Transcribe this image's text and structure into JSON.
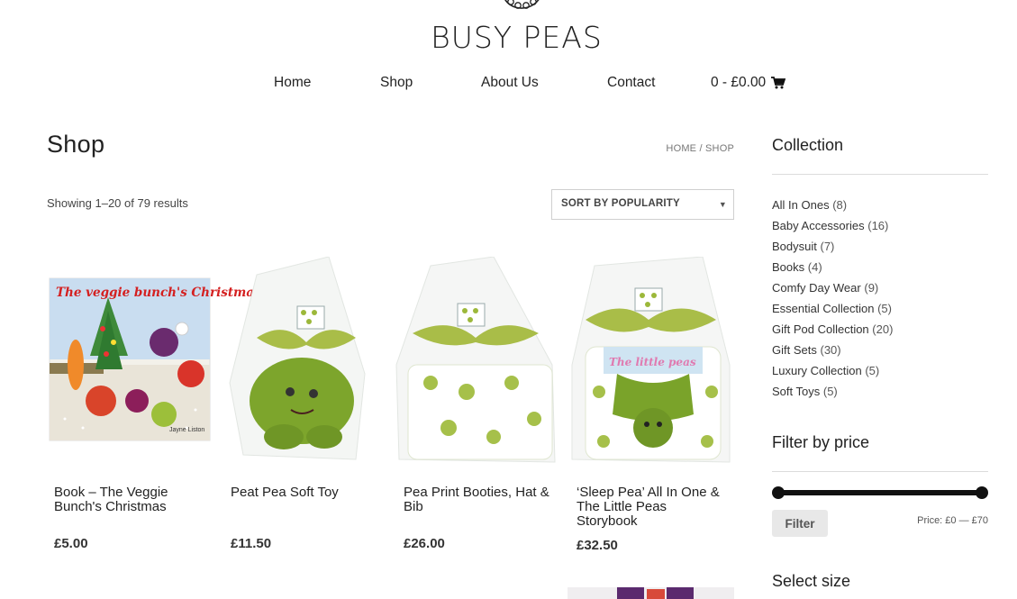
{
  "brand": {
    "name": "BUSY PEAS"
  },
  "nav": {
    "home": "Home",
    "shop": "Shop",
    "about": "About Us",
    "contact": "Contact",
    "cart": "0 - £0.00"
  },
  "page": {
    "title": "Shop",
    "breadcrumb_home": "HOME",
    "breadcrumb_sep": " / ",
    "breadcrumb_current": "SHOP",
    "result_count": "Showing 1–20 of 79 results",
    "sort": {
      "selected": "SORT BY POPULARITY"
    }
  },
  "products": [
    {
      "name": "Book – The Veggie Bunch's Christmas",
      "price": "£5.00",
      "image_title": "The veggie bunch's Christmas",
      "image_author": "Jayne Liston"
    },
    {
      "name": "Peat Pea Soft Toy",
      "price": "£11.50"
    },
    {
      "name": "Pea Print Booties, Hat & Bib",
      "price": "£26.00"
    },
    {
      "name": "‘Sleep Pea’ All In One & The Little Peas Storybook",
      "price": "£32.50",
      "image_label": "The little peas"
    }
  ],
  "sidebar": {
    "collection_title": "Collection",
    "categories": [
      {
        "label": "All In Ones",
        "count": "(8)"
      },
      {
        "label": "Baby Accessories",
        "count": "(16)"
      },
      {
        "label": "Bodysuit",
        "count": "(7)"
      },
      {
        "label": "Books",
        "count": "(4)"
      },
      {
        "label": "Comfy Day Wear",
        "count": "(9)"
      },
      {
        "label": "Essential Collection",
        "count": "(5)"
      },
      {
        "label": "Gift Pod Collection",
        "count": "(20)"
      },
      {
        "label": "Gift Sets",
        "count": "(30)"
      },
      {
        "label": "Luxury Collection",
        "count": "(5)"
      },
      {
        "label": "Soft Toys",
        "count": "(5)"
      }
    ],
    "filter_price_title": "Filter by price",
    "filter_button": "Filter",
    "price_label": "Price: £0 — £70",
    "select_size_title": "Select size"
  },
  "colors": {
    "pea_green": "#8aa832",
    "text": "#222222",
    "button_bg": "#e8e8e8"
  },
  "icons": {
    "cart": "shopping-cart-icon"
  }
}
